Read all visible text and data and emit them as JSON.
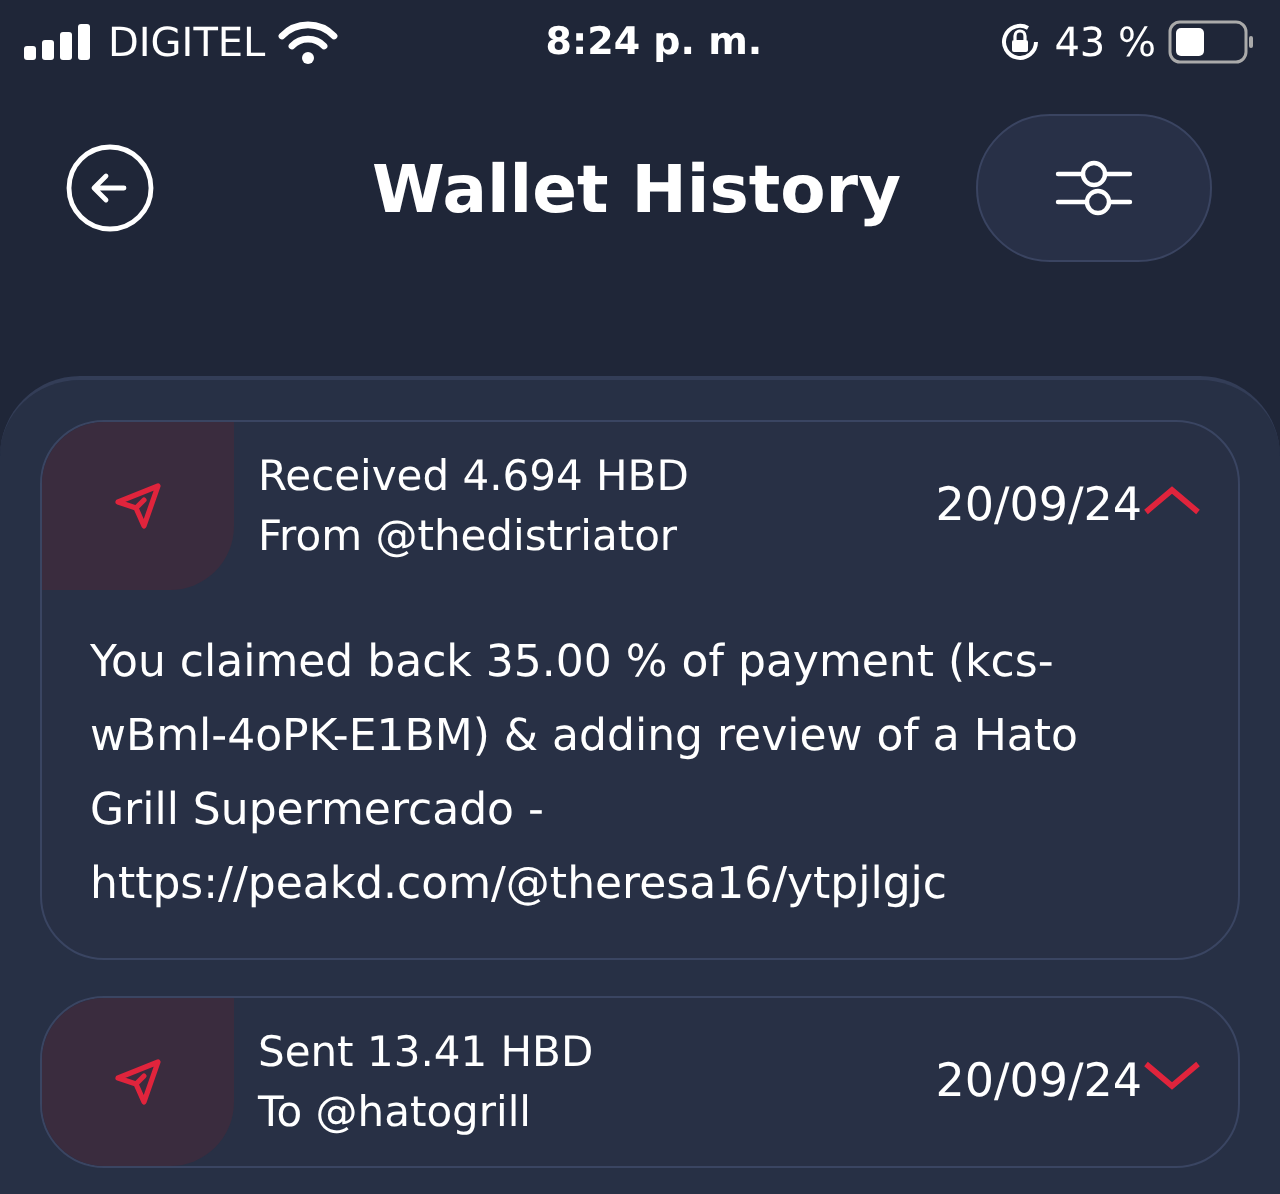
{
  "status_bar": {
    "carrier": "DIGITEL",
    "time": "8:24 p. m.",
    "battery": "43 %"
  },
  "header": {
    "title": "Wallet History"
  },
  "transactions": [
    {
      "title": "Received 4.694 HBD",
      "party": "From @thedistriator",
      "date": "20/09/24",
      "expanded": true,
      "detail": "You claimed back 35.00 % of payment (kcs-wBml-4oPK-E1BM) & adding review of a Hato Grill Supermercado - https://peakd.com/@theresa16/ytpjlgjc"
    },
    {
      "title": "Sent 13.41 HBD",
      "party": "To @hatogrill",
      "date": "20/09/24",
      "expanded": false
    }
  ]
}
